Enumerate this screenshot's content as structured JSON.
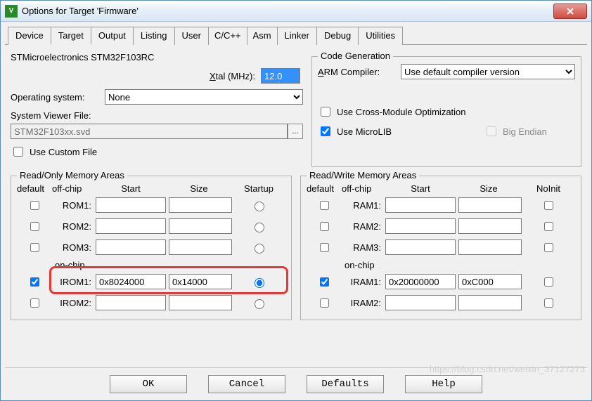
{
  "window": {
    "title": "Options for Target 'Firmware'"
  },
  "tabs": [
    "Device",
    "Target",
    "Output",
    "Listing",
    "User",
    "C/C++",
    "Asm",
    "Linker",
    "Debug",
    "Utilities"
  ],
  "active_tab": 1,
  "device": {
    "mcu_label": "STMicroelectronics STM32F103RC"
  },
  "xtal": {
    "label": "Xtal (MHz):",
    "value": "12.0"
  },
  "os": {
    "label": "Operating system:",
    "value": "None"
  },
  "svf": {
    "label": "System Viewer File:",
    "value": "STM32F103xx.svd",
    "custom_label": "Use Custom File"
  },
  "codegen": {
    "legend": "Code Generation",
    "armcomp_label": "ARM Compiler:",
    "armcomp_value": "Use default compiler version",
    "cross_label": "Use Cross-Module Optimization",
    "microlib_label": "Use MicroLIB",
    "bigendian_label": "Big Endian"
  },
  "ro": {
    "legend": "Read/Only Memory Areas",
    "hdr": {
      "default": "default",
      "off": "off-chip",
      "start": "Start",
      "size": "Size",
      "last": "Startup"
    },
    "rows": [
      {
        "name": "ROM1:",
        "start": "",
        "size": "",
        "def": false,
        "startup": false
      },
      {
        "name": "ROM2:",
        "start": "",
        "size": "",
        "def": false,
        "startup": false
      },
      {
        "name": "ROM3:",
        "start": "",
        "size": "",
        "def": false,
        "startup": false
      }
    ],
    "onchip_label": "on-chip",
    "onchip_rows": [
      {
        "name": "IROM1:",
        "start": "0x8024000",
        "size": "0x14000",
        "def": true,
        "startup": true
      },
      {
        "name": "IROM2:",
        "start": "",
        "size": "",
        "def": false,
        "startup": false
      }
    ]
  },
  "rw": {
    "legend": "Read/Write Memory Areas",
    "hdr": {
      "default": "default",
      "off": "off-chip",
      "start": "Start",
      "size": "Size",
      "last": "NoInit"
    },
    "rows": [
      {
        "name": "RAM1:",
        "start": "",
        "size": "",
        "def": false,
        "noinit": false
      },
      {
        "name": "RAM2:",
        "start": "",
        "size": "",
        "def": false,
        "noinit": false
      },
      {
        "name": "RAM3:",
        "start": "",
        "size": "",
        "def": false,
        "noinit": false
      }
    ],
    "onchip_label": "on-chip",
    "onchip_rows": [
      {
        "name": "IRAM1:",
        "start": "0x20000000",
        "size": "0xC000",
        "def": true,
        "noinit": false
      },
      {
        "name": "IRAM2:",
        "start": "",
        "size": "",
        "def": false,
        "noinit": false
      }
    ]
  },
  "buttons": {
    "ok": "OK",
    "cancel": "Cancel",
    "defaults": "Defaults",
    "help": "Help"
  },
  "watermark": "https://blog.csdn.net/weixin_37127273"
}
